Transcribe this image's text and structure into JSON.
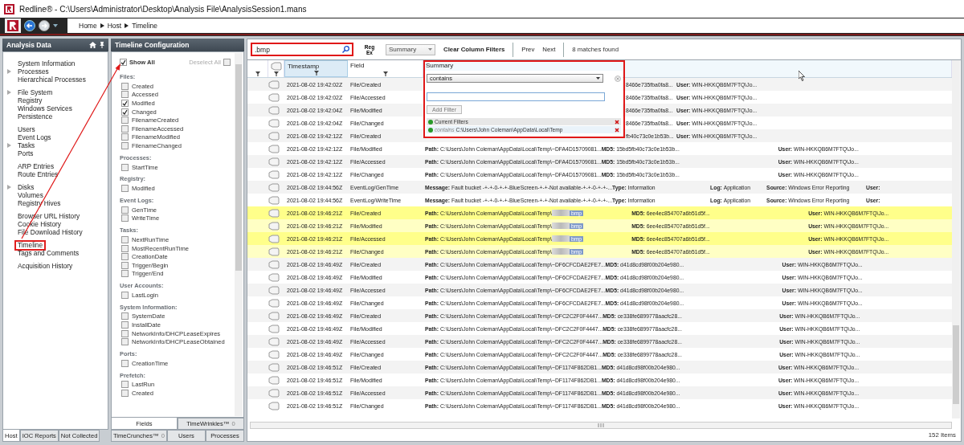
{
  "window": {
    "title": "Redline® - C:\\Users\\Administrator\\Desktop\\Analysis File\\AnalysisSession1.mans"
  },
  "breadcrumb": [
    "Home",
    "Host",
    "Timeline"
  ],
  "analysis_panel": {
    "title": "Analysis Data",
    "groups": [
      [
        {
          "label": "System Information",
          "expandable": false,
          "selected": false
        },
        {
          "label": "Processes",
          "expandable": true,
          "selected": false
        },
        {
          "label": "Hierarchical Processes",
          "expandable": false,
          "selected": false
        }
      ],
      [
        {
          "label": "File System",
          "expandable": true,
          "selected": false
        },
        {
          "label": "Registry",
          "expandable": false,
          "selected": false
        },
        {
          "label": "Windows Services",
          "expandable": false,
          "selected": false
        },
        {
          "label": "Persistence",
          "expandable": false,
          "selected": false
        }
      ],
      [
        {
          "label": "Users",
          "expandable": false,
          "selected": false
        },
        {
          "label": "Event Logs",
          "expandable": false,
          "selected": false
        },
        {
          "label": "Tasks",
          "expandable": true,
          "selected": false
        },
        {
          "label": "Ports",
          "expandable": false,
          "selected": false
        }
      ],
      [
        {
          "label": "ARP Entries",
          "expandable": false,
          "selected": false
        },
        {
          "label": "Route Entries",
          "expandable": false,
          "selected": false
        }
      ],
      [
        {
          "label": "Disks",
          "expandable": true,
          "selected": false
        },
        {
          "label": "Volumes",
          "expandable": false,
          "selected": false
        },
        {
          "label": "Registry Hives",
          "expandable": false,
          "selected": false
        }
      ],
      [
        {
          "label": "Browser URL History",
          "expandable": false,
          "selected": false
        },
        {
          "label": "Cookie History",
          "expandable": false,
          "selected": false
        },
        {
          "label": "File Download History",
          "expandable": false,
          "selected": false
        }
      ],
      [
        {
          "label": "Timeline",
          "expandable": false,
          "selected": true
        },
        {
          "label": "Tags and Comments",
          "expandable": false,
          "selected": false
        }
      ],
      [
        {
          "label": "Acquisition History",
          "expandable": false,
          "selected": false
        }
      ]
    ],
    "tabs": [
      {
        "label": "Host",
        "selected": true
      },
      {
        "label": "IOC Reports",
        "selected": false
      },
      {
        "label": "Not Collected",
        "selected": false
      }
    ]
  },
  "timeline_config": {
    "title": "Timeline Configuration",
    "show_all": {
      "label": "Show All",
      "checked": true
    },
    "deselect_all": {
      "label": "Deselect All",
      "checked": false
    },
    "groups": [
      {
        "heading": "Files:",
        "items": [
          {
            "label": "Created",
            "checked": false
          },
          {
            "label": "Accessed",
            "checked": false
          },
          {
            "label": "Modified",
            "checked": true
          },
          {
            "label": "Changed",
            "checked": true
          },
          {
            "label": "FilenameCreated",
            "checked": false
          },
          {
            "label": "FilenameAccessed",
            "checked": false
          },
          {
            "label": "FilenameModified",
            "checked": false
          },
          {
            "label": "FilenameChanged",
            "checked": false
          }
        ]
      },
      {
        "heading": "Processes:",
        "items": [
          {
            "label": "StartTime",
            "checked": false
          }
        ]
      },
      {
        "heading": "Registry:",
        "items": [
          {
            "label": "Modified",
            "checked": false
          }
        ]
      },
      {
        "heading": "Event Logs:",
        "items": [
          {
            "label": "GenTime",
            "checked": false
          },
          {
            "label": "WriteTime",
            "checked": false
          }
        ]
      },
      {
        "heading": "Tasks:",
        "items": [
          {
            "label": "NextRunTime",
            "checked": false
          },
          {
            "label": "MostRecentRunTime",
            "checked": false
          },
          {
            "label": "CreationDate",
            "checked": false
          },
          {
            "label": "Trigger/Begin",
            "checked": false
          },
          {
            "label": "Trigger/End",
            "checked": false
          }
        ]
      },
      {
        "heading": "User Accounts:",
        "items": [
          {
            "label": "LastLogin",
            "checked": false
          }
        ]
      },
      {
        "heading": "System Information:",
        "items": [
          {
            "label": "SystemDate",
            "checked": false
          },
          {
            "label": "InstallDate",
            "checked": false
          },
          {
            "label": "NetworkInfo/DHCPLeaseExpires",
            "checked": false
          },
          {
            "label": "NetworkInfo/DHCPLeaseObtained",
            "checked": false
          }
        ]
      },
      {
        "heading": "Ports:",
        "items": [
          {
            "label": "CreationTime",
            "checked": false
          }
        ]
      },
      {
        "heading": "Prefetch:",
        "items": [
          {
            "label": "LastRun",
            "checked": false
          },
          {
            "label": "Created",
            "checked": false
          }
        ]
      }
    ],
    "tabs": [
      [
        {
          "label": "Fields",
          "selected": true
        },
        {
          "label": "TimeWrinkles™",
          "count": "0",
          "selected": false
        }
      ],
      [
        {
          "label": "TimeCrunches™",
          "count": "0",
          "selected": false
        },
        {
          "label": "Users",
          "selected": false
        },
        {
          "label": "Processes",
          "selected": false
        }
      ]
    ]
  },
  "toolbar": {
    "search": ".bmp",
    "regex": "Reg Ex",
    "column": "Summary",
    "clear": "Clear Column Filters",
    "prev": "Prev",
    "next": "Next",
    "matches": "8 matches found"
  },
  "table": {
    "columns": [
      {
        "kind": "blank",
        "sorted": false
      },
      {
        "kind": "tag",
        "sorted": false
      },
      {
        "kind": "text",
        "label": "Timestamp",
        "sorted": true
      },
      {
        "kind": "text",
        "label": "Field",
        "sorted": false
      },
      {
        "kind": "text",
        "label": "Summary",
        "sorted": false
      }
    ],
    "rows": [
      {
        "timestamp": "2021-08-02 19:42:02Z",
        "field": "File/Created",
        "kind": "file_covered",
        "highlighted": false,
        "summary": [
          {
            "value": "8466e735fba0fa8..."
          },
          {
            "label": "User:",
            "value": "WIN-HKKQB6M7FTQ\\Jo..."
          }
        ]
      },
      {
        "timestamp": "2021-08-02 19:42:02Z",
        "field": "File/Accessed",
        "kind": "file_covered",
        "highlighted": false,
        "summary": [
          {
            "value": "8466e735fba0fa8..."
          },
          {
            "label": "User:",
            "value": "WIN-HKKQB6M7FTQ\\Jo..."
          }
        ]
      },
      {
        "timestamp": "2021-08-02 19:42:04Z",
        "field": "File/Modified",
        "kind": "file_covered",
        "highlighted": false,
        "summary": [
          {
            "value": "8466e735fba0fa8..."
          },
          {
            "label": "User:",
            "value": "WIN-HKKQB6M7FTQ\\Jo..."
          }
        ]
      },
      {
        "timestamp": "2021-08-02 19:42:04Z",
        "field": "File/Changed",
        "kind": "file_covered",
        "highlighted": false,
        "summary": [
          {
            "value": "8466e735fba0fa8..."
          },
          {
            "label": "User:",
            "value": "WIN-HKKQB6M7FTQ\\Jo..."
          }
        ]
      },
      {
        "timestamp": "2021-08-02 19:42:12Z",
        "field": "File/Created",
        "kind": "file_covered",
        "highlighted": false,
        "summary": [
          {
            "value": "fb40c73c0e1b53b..."
          },
          {
            "label": "User:",
            "value": "WIN-HKKQB6M7FTQ\\Jo..."
          }
        ]
      },
      {
        "timestamp": "2021-08-02 19:42:12Z",
        "field": "File/Modified",
        "kind": "file",
        "highlighted": false,
        "summary": [
          {
            "label": "Path:",
            "value": "C:\\Users\\John Coleman\\AppData\\Local\\Temp\\~DFA4D15709081..."
          },
          {
            "label": "MD5:",
            "value": "15bd5fb40c73c0e1b53b..."
          },
          {
            "label": "User:",
            "value": "WIN-HKKQB6M7FTQ\\Jo..."
          }
        ]
      },
      {
        "timestamp": "2021-08-02 19:42:12Z",
        "field": "File/Accessed",
        "kind": "file",
        "highlighted": false,
        "summary": [
          {
            "label": "Path:",
            "value": "C:\\Users\\John Coleman\\AppData\\Local\\Temp\\~DFA4D15709081..."
          },
          {
            "label": "MD5:",
            "value": "15bd5fb40c73c0e1b53b..."
          },
          {
            "label": "User:",
            "value": "WIN-HKKQB6M7FTQ\\Jo..."
          }
        ]
      },
      {
        "timestamp": "2021-08-02 19:42:12Z",
        "field": "File/Changed",
        "kind": "file",
        "highlighted": false,
        "summary": [
          {
            "label": "Path:",
            "value": "C:\\Users\\John Coleman\\AppData\\Local\\Temp\\~DFA4D15709081..."
          },
          {
            "label": "MD5:",
            "value": "15bd5fb40c73c0e1b53b..."
          },
          {
            "label": "User:",
            "value": "WIN-HKKQB6M7FTQ\\Jo..."
          }
        ]
      },
      {
        "timestamp": "2021-08-02 19:44:56Z",
        "field": "EventLog/GenTime",
        "kind": "event",
        "highlighted": false,
        "summary": [
          {
            "label": "Message:",
            "value": "Fault bucket -+-+-0-+-+-BlueScreen-+-+-Not available-+-+-0-+-+-..."
          },
          {
            "label": "Type:",
            "value": "Information"
          },
          {
            "label": "Log:",
            "value": "Application"
          },
          {
            "label": "Source:",
            "value": "Windows Error Reporting"
          },
          {
            "label": "User:"
          }
        ]
      },
      {
        "timestamp": "2021-08-02 19:44:56Z",
        "field": "EventLog/WriteTime",
        "kind": "event",
        "highlighted": false,
        "summary": [
          {
            "label": "Message:",
            "value": "Fault bucket -+-+-0-+-+-BlueScreen-+-+-Not available-+-+-0-+-+-..."
          },
          {
            "label": "Type:",
            "value": "Information"
          },
          {
            "label": "Log:",
            "value": "Application"
          },
          {
            "label": "Source:",
            "value": "Windows Error Reporting"
          },
          {
            "label": "User:"
          }
        ]
      },
      {
        "timestamp": "2021-08-02 19:46:21Z",
        "field": "File/Created",
        "kind": "file",
        "highlighted": true,
        "summary": [
          {
            "label": "Path:",
            "value": "C:\\Users\\John Coleman\\AppData\\Local\\Temp\\",
            "match": "bmp"
          },
          {
            "label": "MD5:",
            "value": "6ee4ec854707a6b51d5f..."
          },
          {
            "label": "User:",
            "value": "WIN-HKKQB6M7FTQ\\Jo..."
          }
        ]
      },
      {
        "timestamp": "2021-08-02 19:46:21Z",
        "field": "File/Modified",
        "kind": "file",
        "highlighted": true,
        "summary": [
          {
            "label": "Path:",
            "value": "C:\\Users\\John Coleman\\AppData\\Local\\Temp\\",
            "match": "bmp"
          },
          {
            "label": "MD5:",
            "value": "6ee4ec854707a6b51d5f..."
          },
          {
            "label": "User:",
            "value": "WIN-HKKQB6M7FTQ\\Jo..."
          }
        ]
      },
      {
        "timestamp": "2021-08-02 19:46:21Z",
        "field": "File/Accessed",
        "kind": "file",
        "highlighted": true,
        "summary": [
          {
            "label": "Path:",
            "value": "C:\\Users\\John Coleman\\AppData\\Local\\Temp\\",
            "match": "bmp"
          },
          {
            "label": "MD5:",
            "value": "6ee4ec854707a6b51d5f..."
          },
          {
            "label": "User:",
            "value": "WIN-HKKQB6M7FTQ\\Jo..."
          }
        ]
      },
      {
        "timestamp": "2021-08-02 19:46:21Z",
        "field": "File/Changed",
        "kind": "file",
        "highlighted": true,
        "summary": [
          {
            "label": "Path:",
            "value": "C:\\Users\\John Coleman\\AppData\\Local\\Temp\\",
            "match": "bmp"
          },
          {
            "label": "MD5:",
            "value": "6ee4ec854707a6b51d5f..."
          },
          {
            "label": "User:",
            "value": "WIN-HKKQB6M7FTQ\\Jo..."
          }
        ]
      },
      {
        "timestamp": "2021-08-02 19:46:49Z",
        "field": "File/Created",
        "kind": "file",
        "highlighted": false,
        "summary": [
          {
            "label": "Path:",
            "value": "C:\\Users\\John Coleman\\AppData\\Local\\Temp\\~DF6CFCDAE2FE7..."
          },
          {
            "label": "MD5:",
            "value": "d41d8cd98f00b204e980..."
          },
          {
            "label": "User:",
            "value": "WIN-HKKQB6M7FTQ\\Jo..."
          }
        ]
      },
      {
        "timestamp": "2021-08-02 19:46:49Z",
        "field": "File/Modified",
        "kind": "file",
        "highlighted": false,
        "summary": [
          {
            "label": "Path:",
            "value": "C:\\Users\\John Coleman\\AppData\\Local\\Temp\\~DF6CFCDAE2FE7..."
          },
          {
            "label": "MD5:",
            "value": "d41d8cd98f00b204e980..."
          },
          {
            "label": "User:",
            "value": "WIN-HKKQB6M7FTQ\\Jo..."
          }
        ]
      },
      {
        "timestamp": "2021-08-02 19:46:49Z",
        "field": "File/Accessed",
        "kind": "file",
        "highlighted": false,
        "summary": [
          {
            "label": "Path:",
            "value": "C:\\Users\\John Coleman\\AppData\\Local\\Temp\\~DF6CFCDAE2FE7..."
          },
          {
            "label": "MD5:",
            "value": "d41d8cd98f00b204e980..."
          },
          {
            "label": "User:",
            "value": "WIN-HKKQB6M7FTQ\\Jo..."
          }
        ]
      },
      {
        "timestamp": "2021-08-02 19:46:49Z",
        "field": "File/Changed",
        "kind": "file",
        "highlighted": false,
        "summary": [
          {
            "label": "Path:",
            "value": "C:\\Users\\John Coleman\\AppData\\Local\\Temp\\~DF6CFCDAE2FE7..."
          },
          {
            "label": "MD5:",
            "value": "d41d8cd98f00b204e980..."
          },
          {
            "label": "User:",
            "value": "WIN-HKKQB6M7FTQ\\Jo..."
          }
        ]
      },
      {
        "timestamp": "2021-08-02 19:46:49Z",
        "field": "File/Created",
        "kind": "file",
        "highlighted": false,
        "summary": [
          {
            "label": "Path:",
            "value": "C:\\Users\\John Coleman\\AppData\\Local\\Temp\\~DFC2C2F0F4447..."
          },
          {
            "label": "MD5:",
            "value": "ce338fe6899778aacfc28..."
          },
          {
            "label": "User:",
            "value": "WIN-HKKQB6M7FTQ\\Jo..."
          }
        ]
      },
      {
        "timestamp": "2021-08-02 19:46:49Z",
        "field": "File/Modified",
        "kind": "file",
        "highlighted": false,
        "summary": [
          {
            "label": "Path:",
            "value": "C:\\Users\\John Coleman\\AppData\\Local\\Temp\\~DFC2C2F0F4447..."
          },
          {
            "label": "MD5:",
            "value": "ce338fe6899778aacfc28..."
          },
          {
            "label": "User:",
            "value": "WIN-HKKQB6M7FTQ\\Jo..."
          }
        ]
      },
      {
        "timestamp": "2021-08-02 19:46:49Z",
        "field": "File/Accessed",
        "kind": "file",
        "highlighted": false,
        "summary": [
          {
            "label": "Path:",
            "value": "C:\\Users\\John Coleman\\AppData\\Local\\Temp\\~DFC2C2F0F4447..."
          },
          {
            "label": "MD5:",
            "value": "ce338fe6899778aacfc28..."
          },
          {
            "label": "User:",
            "value": "WIN-HKKQB6M7FTQ\\Jo..."
          }
        ]
      },
      {
        "timestamp": "2021-08-02 19:46:49Z",
        "field": "File/Changed",
        "kind": "file",
        "highlighted": false,
        "summary": [
          {
            "label": "Path:",
            "value": "C:\\Users\\John Coleman\\AppData\\Local\\Temp\\~DFC2C2F0F4447..."
          },
          {
            "label": "MD5:",
            "value": "ce338fe6899778aacfc28..."
          },
          {
            "label": "User:",
            "value": "WIN-HKKQB6M7FTQ\\Jo..."
          }
        ]
      },
      {
        "timestamp": "2021-08-02 19:46:51Z",
        "field": "File/Created",
        "kind": "file",
        "highlighted": false,
        "summary": [
          {
            "label": "Path:",
            "value": "C:\\Users\\John Coleman\\AppData\\Local\\Temp\\~DF1174F862DB1..."
          },
          {
            "label": "MD5:",
            "value": "d41d8cd98f00b204e980..."
          },
          {
            "label": "User:",
            "value": "WIN-HKKQB6M7FTQ\\Jo..."
          }
        ]
      },
      {
        "timestamp": "2021-08-02 19:46:51Z",
        "field": "File/Modified",
        "kind": "file",
        "highlighted": false,
        "summary": [
          {
            "label": "Path:",
            "value": "C:\\Users\\John Coleman\\AppData\\Local\\Temp\\~DF1174F862DB1..."
          },
          {
            "label": "MD5:",
            "value": "d41d8cd98f00b204e980..."
          },
          {
            "label": "User:",
            "value": "WIN-HKKQB6M7FTQ\\Jo..."
          }
        ]
      },
      {
        "timestamp": "2021-08-02 19:46:51Z",
        "field": "File/Accessed",
        "kind": "file",
        "highlighted": false,
        "summary": [
          {
            "label": "Path:",
            "value": "C:\\Users\\John Coleman\\AppData\\Local\\Temp\\~DF1174F862DB1..."
          },
          {
            "label": "MD5:",
            "value": "d41d8cd98f00b204e980..."
          },
          {
            "label": "User:",
            "value": "WIN-HKKQB6M7FTQ\\Jo..."
          }
        ]
      },
      {
        "timestamp": "2021-08-02 19:46:51Z",
        "field": "File/Changed",
        "kind": "file",
        "highlighted": false,
        "summary": [
          {
            "label": "Path:",
            "value": "C:\\Users\\John Coleman\\AppData\\Local\\Temp\\~DF1174F862DB1..."
          },
          {
            "label": "MD5:",
            "value": "d41d8cd98f00b204e980..."
          },
          {
            "label": "User:",
            "value": "WIN-HKKQB6M7FTQ\\Jo..."
          }
        ]
      }
    ],
    "filter_popup": {
      "operator": "contains",
      "add_button": "Add Filter",
      "current_label": "Current Filters",
      "filters": [
        {
          "operator": "contains",
          "value": "C:\\Users\\John Coleman\\AppData\\Local\\Temp"
        }
      ]
    }
  },
  "status": "152 Items"
}
